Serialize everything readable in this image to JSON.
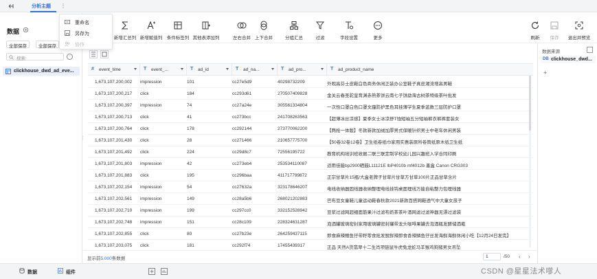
{
  "topbar": {
    "tab_label": "分析主题",
    "more_glyph": "⋮"
  },
  "menu": {
    "items": [
      {
        "label": "重命名",
        "icon": "rename-icon",
        "enabled": true
      },
      {
        "label": "另存为",
        "icon": "save-as-icon",
        "enabled": true
      },
      {
        "label": "协作",
        "icon": "collab-icon",
        "enabled": false
      }
    ]
  },
  "left": {
    "title": "数据",
    "btn_save_all": "全部保存",
    "btn_save_all2": "全部保存",
    "search_placeholder": "搜索",
    "dataset_name": "clickhouse_dwd_ad_eve..."
  },
  "toolbar": {
    "tools": [
      {
        "label": "新增汇总列",
        "icon": "sum-column-icon"
      },
      {
        "label": "新增赋值列",
        "icon": "formula-column-icon"
      },
      {
        "label": "条件标签列",
        "icon": "condition-tag-icon"
      },
      {
        "label": "其他表添加列",
        "icon": "add-from-table-icon"
      },
      {
        "label": "左右合并",
        "icon": "join-icon"
      },
      {
        "label": "上下合并",
        "icon": "union-icon"
      },
      {
        "label": "分组汇总",
        "icon": "group-icon"
      },
      {
        "label": "过滤",
        "icon": "filter-icon"
      },
      {
        "label": "字段设置",
        "icon": "field-setting-icon"
      },
      {
        "label": "更多",
        "icon": "more-icon"
      }
    ],
    "right_tools": [
      {
        "label": "刷新",
        "icon": "refresh-icon",
        "enabled": true
      },
      {
        "label": "保存",
        "icon": "save-icon",
        "enabled": false
      },
      {
        "label": "退出并预览",
        "icon": "exit-preview-icon",
        "enabled": true
      }
    ]
  },
  "table": {
    "columns": [
      {
        "type": "#",
        "name": "event_time"
      },
      {
        "type": "T",
        "name": "event_..."
      },
      {
        "type": "T",
        "name": "ad_id"
      },
      {
        "type": "T",
        "name": "ad_na..."
      },
      {
        "type": "T",
        "name": "ad_pro..."
      },
      {
        "type": "T",
        "name": "ad_product_name"
      }
    ],
    "rows": [
      [
        "1,673,107,200,002",
        "impression",
        "101",
        "cc27e5d9",
        "40298732209",
        "外观高芬士皮鞋白色商务休闲正装办公室鞋子真皮潮流增高男鞋"
      ],
      [
        "1,673,107,200,217",
        "click",
        "184",
        "cc293d61",
        "270507409828",
        "金关云春圣驼皇育渊赤熟茶饼云南七子饼勐海古树茶特级茶叶批发"
      ],
      [
        "1,673,107,200,397",
        "impression",
        "74",
        "cc27a24e",
        "305561334804",
        "一次性口罩白色口罩文蕴防护黑色耳挂薄学生夏季蓝数三层防护口罩"
      ],
      [
        "1,673,107,200,713",
        "click",
        "41",
        "cc273bcc",
        "241708263563",
        "【超薄冰丝凉感】夏季女士冰凉舒T恤短袖五分短袖裤衣裤裤套装女"
      ],
      [
        "1,673,107,200,764",
        "click",
        "178",
        "cc292144",
        "273770062200",
        "【两抢一体版】冬款新款加绒加厚男式保暖针织男士中老年休闲男装"
      ],
      [
        "1,673,107,201,430",
        "click",
        "28",
        "cc271466",
        "210657775700",
        "【50卷32卷12卷】卫生纸卷纸巾家用实惠装原所卷筒纸原木纸卫生纸"
      ],
      [
        "1,673,107,201,492",
        "click",
        "224",
        "cc29d8c7",
        "72556195722",
        "教育机构培训班收据二联三联定制学校幼儿园兴趣班入学合同印刷"
      ],
      [
        "1,673,107,201,803",
        "impression",
        "42",
        "cc273eb4",
        "253534110087",
        "适用佳能bp2900硒鼓L11121E lbP4010b mf4012b 墨盒 Canon CRG303"
      ],
      [
        "1,673,107,201,883",
        "click",
        "195",
        "cc296baa",
        "411717799872",
        "正宗甘草片15瓶/大盒老牌子甘草片甘草方甘草100片正品甘草含片"
      ],
      [
        "1,673,107,202,154",
        "impression",
        "54",
        "cc27632a",
        "323178646207",
        "电线收纳器固线器收纳整理电线挂钩桌面理线万能自粘整力包理线器"
      ],
      [
        "1,673,107,202,561",
        "impression",
        "149",
        "cc28a5b6",
        "268021202883",
        "巴布豆女童鞋儿童运动鞋春秋款2021新款百搭网鞋透气中大童女孩子"
      ],
      [
        "1,673,107,202,710",
        "impression",
        "199",
        "cc297cc0",
        "332152528942",
        "豆浆过滤网超细面筋果汁过滤布奶茶茶叶酒网滤过滤神器无漂过滤袋"
      ],
      [
        "1,673,107,202,748",
        "impression",
        "151",
        "cc28c109",
        "228324631287",
        "泡酒罐玻璃密封家用玻璃罐密封罐带龙头咖啡果罐去泡酒瓶发酵储酒瓶"
      ],
      [
        "1,673,107,202,855",
        "click",
        "80",
        "cc27b23e",
        "264259437115",
        "即食麻辣鳍鱼仔带籽零食批发鱿鲜辣即食香辣鳞鱼仔丝发海鲜海鲜休闲小吃【12月24日发完】"
      ],
      [
        "1,673,107,203,075",
        "click",
        "181",
        "cc292f74",
        "17455439317",
        "正品 天然A货翡翠十二生肖项链鼠牛虎兔龙蛇马羊猴鸡狗猪男女吊坠"
      ]
    ]
  },
  "footer": {
    "prefix": "显示前",
    "count": "5,000",
    "suffix": "条数据",
    "page": "1",
    "total": "/50"
  },
  "right": {
    "header": "数据来源",
    "badge": "DB",
    "source_name": "clickhouse_dwd..."
  },
  "bottom": {
    "tab_data": "数据",
    "tab_component": "组件"
  },
  "watermark": "CSDN @星星法术嗲人"
}
